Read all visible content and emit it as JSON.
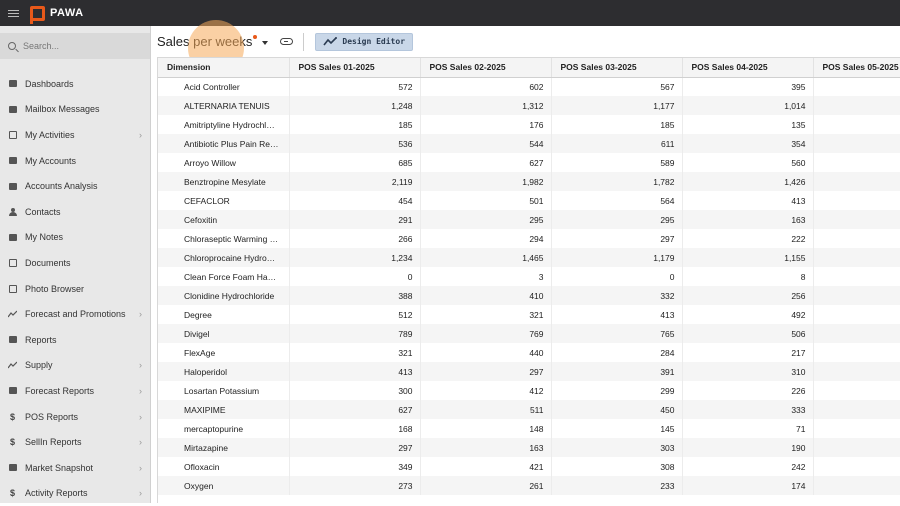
{
  "app": {
    "brand": "PAWA"
  },
  "search": {
    "placeholder": "Search..."
  },
  "sidebar": {
    "items": [
      {
        "label": "Dashboards",
        "has_children": false
      },
      {
        "label": "Mailbox Messages",
        "has_children": false
      },
      {
        "label": "My Activities",
        "has_children": true
      },
      {
        "label": "My Accounts",
        "has_children": false
      },
      {
        "label": "Accounts Analysis",
        "has_children": false
      },
      {
        "label": "Contacts",
        "has_children": false
      },
      {
        "label": "My Notes",
        "has_children": false
      },
      {
        "label": "Documents",
        "has_children": false
      },
      {
        "label": "Photo Browser",
        "has_children": false
      },
      {
        "label": "Forecast and Promotions",
        "has_children": true
      },
      {
        "label": "Reports",
        "has_children": false
      },
      {
        "label": "Supply",
        "has_children": true
      },
      {
        "label": "Forecast Reports",
        "has_children": true
      },
      {
        "label": "POS Reports",
        "has_children": true
      },
      {
        "label": "SellIn Reports",
        "has_children": true
      },
      {
        "label": "Market Snapshot",
        "has_children": true
      },
      {
        "label": "Activity Reports",
        "has_children": true
      }
    ]
  },
  "toolbar": {
    "title": "Sales per weeks",
    "design_editor_label": "Design Editor"
  },
  "table": {
    "columns": [
      "Dimension",
      "POS Sales 01-2025",
      "POS Sales 02-2025",
      "POS Sales 03-2025",
      "POS Sales 04-2025",
      "POS Sales 05-2025"
    ],
    "rows": [
      [
        "Acid Controller",
        "572",
        "602",
        "567",
        "395",
        ""
      ],
      [
        "ALTERNARIA TENUIS",
        "1,248",
        "1,312",
        "1,177",
        "1,014",
        ""
      ],
      [
        "Amitriptyline Hydrochl…",
        "185",
        "176",
        "185",
        "135",
        ""
      ],
      [
        "Antibiotic Plus Pain Re…",
        "536",
        "544",
        "611",
        "354",
        ""
      ],
      [
        "Arroyo Willow",
        "685",
        "627",
        "589",
        "560",
        ""
      ],
      [
        "Benztropine Mesylate",
        "2,119",
        "1,982",
        "1,782",
        "1,426",
        ""
      ],
      [
        "CEFACLOR",
        "454",
        "501",
        "564",
        "413",
        ""
      ],
      [
        "Cefoxitin",
        "291",
        "295",
        "295",
        "163",
        ""
      ],
      [
        "Chloraseptic Warming …",
        "266",
        "294",
        "297",
        "222",
        ""
      ],
      [
        "Chloroprocaine Hydro…",
        "1,234",
        "1,465",
        "1,179",
        "1,155",
        ""
      ],
      [
        "Clean Force Foam Ha…",
        "0",
        "3",
        "0",
        "8",
        ""
      ],
      [
        "Clonidine Hydrochloride",
        "388",
        "410",
        "332",
        "256",
        ""
      ],
      [
        "Degree",
        "512",
        "321",
        "413",
        "492",
        ""
      ],
      [
        "Divigel",
        "789",
        "769",
        "765",
        "506",
        ""
      ],
      [
        "FlexAge",
        "321",
        "440",
        "284",
        "217",
        ""
      ],
      [
        "Haloperidol",
        "413",
        "297",
        "391",
        "310",
        ""
      ],
      [
        "Losartan Potassium",
        "300",
        "412",
        "299",
        "226",
        ""
      ],
      [
        "MAXIPIME",
        "627",
        "511",
        "450",
        "333",
        ""
      ],
      [
        "mercaptopurine",
        "168",
        "148",
        "145",
        "71",
        ""
      ],
      [
        "Mirtazapine",
        "297",
        "163",
        "303",
        "190",
        ""
      ],
      [
        "Ofloxacin",
        "349",
        "421",
        "308",
        "242",
        ""
      ],
      [
        "Oxygen",
        "273",
        "261",
        "233",
        "174",
        ""
      ]
    ]
  },
  "colors": {
    "accent": "#e8591a",
    "topbar": "#2d2d30",
    "sidebar": "#e8e8e8",
    "button": "#c9d7e8"
  }
}
